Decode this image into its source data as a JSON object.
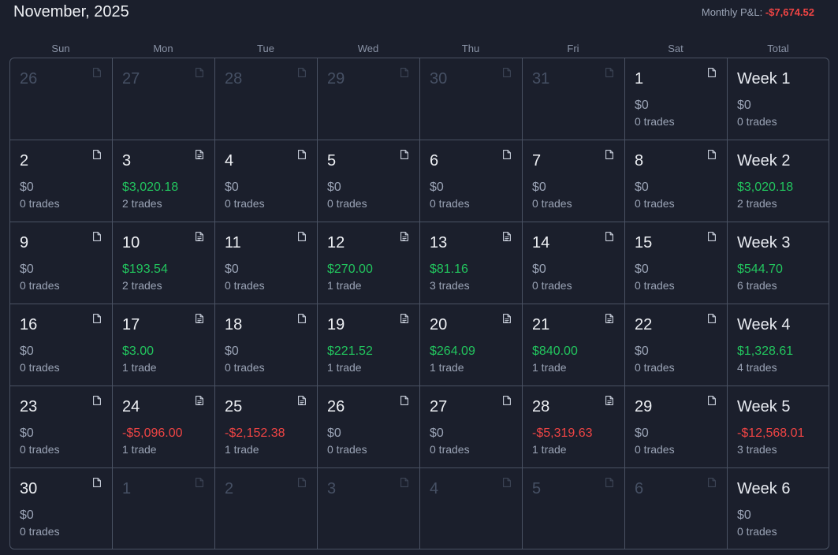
{
  "header": {
    "month_title": "November, 2025",
    "pnl_label": "Monthly P&L:",
    "pnl_value": "-$7,674.52"
  },
  "day_headers": [
    "Sun",
    "Mon",
    "Tue",
    "Wed",
    "Thu",
    "Fri",
    "Sat",
    "Total"
  ],
  "colors": {
    "positive": "#22c55e",
    "negative": "#ef4444",
    "neutral": "#9aa3b5",
    "muted_date": "#465064",
    "background": "#1b1f2c",
    "border": "#4a5263"
  },
  "weeks": [
    {
      "days": [
        {
          "date": "26",
          "muted": true,
          "note": "blank"
        },
        {
          "date": "27",
          "muted": true,
          "note": "blank"
        },
        {
          "date": "28",
          "muted": true,
          "note": "blank"
        },
        {
          "date": "29",
          "muted": true,
          "note": "blank"
        },
        {
          "date": "30",
          "muted": true,
          "note": "blank"
        },
        {
          "date": "31",
          "muted": true,
          "note": "blank"
        },
        {
          "date": "1",
          "amount": "$0",
          "trades": "0 trades",
          "sign": "zero",
          "note": "blank"
        }
      ],
      "total": {
        "label": "Week 1",
        "amount": "$0",
        "trades": "0 trades",
        "sign": "zero"
      }
    },
    {
      "days": [
        {
          "date": "2",
          "amount": "$0",
          "trades": "0 trades",
          "sign": "zero",
          "note": "blank"
        },
        {
          "date": "3",
          "amount": "$3,020.18",
          "trades": "2 trades",
          "sign": "pos",
          "note": "filled"
        },
        {
          "date": "4",
          "amount": "$0",
          "trades": "0 trades",
          "sign": "zero",
          "note": "blank"
        },
        {
          "date": "5",
          "amount": "$0",
          "trades": "0 trades",
          "sign": "zero",
          "note": "blank"
        },
        {
          "date": "6",
          "amount": "$0",
          "trades": "0 trades",
          "sign": "zero",
          "note": "blank"
        },
        {
          "date": "7",
          "amount": "$0",
          "trades": "0 trades",
          "sign": "zero",
          "note": "blank"
        },
        {
          "date": "8",
          "amount": "$0",
          "trades": "0 trades",
          "sign": "zero",
          "note": "blank"
        }
      ],
      "total": {
        "label": "Week 2",
        "amount": "$3,020.18",
        "trades": "2 trades",
        "sign": "pos"
      }
    },
    {
      "days": [
        {
          "date": "9",
          "amount": "$0",
          "trades": "0 trades",
          "sign": "zero",
          "note": "blank"
        },
        {
          "date": "10",
          "amount": "$193.54",
          "trades": "2 trades",
          "sign": "pos",
          "note": "filled"
        },
        {
          "date": "11",
          "amount": "$0",
          "trades": "0 trades",
          "sign": "zero",
          "note": "blank"
        },
        {
          "date": "12",
          "amount": "$270.00",
          "trades": "1 trade",
          "sign": "pos",
          "note": "filled"
        },
        {
          "date": "13",
          "amount": "$81.16",
          "trades": "3 trades",
          "sign": "pos",
          "note": "filled"
        },
        {
          "date": "14",
          "amount": "$0",
          "trades": "0 trades",
          "sign": "zero",
          "note": "blank"
        },
        {
          "date": "15",
          "amount": "$0",
          "trades": "0 trades",
          "sign": "zero",
          "note": "blank"
        }
      ],
      "total": {
        "label": "Week 3",
        "amount": "$544.70",
        "trades": "6 trades",
        "sign": "pos"
      }
    },
    {
      "days": [
        {
          "date": "16",
          "amount": "$0",
          "trades": "0 trades",
          "sign": "zero",
          "note": "blank"
        },
        {
          "date": "17",
          "amount": "$3.00",
          "trades": "1 trade",
          "sign": "pos",
          "note": "filled"
        },
        {
          "date": "18",
          "amount": "$0",
          "trades": "0 trades",
          "sign": "zero",
          "note": "blank"
        },
        {
          "date": "19",
          "amount": "$221.52",
          "trades": "1 trade",
          "sign": "pos",
          "note": "filled"
        },
        {
          "date": "20",
          "amount": "$264.09",
          "trades": "1 trade",
          "sign": "pos",
          "note": "filled"
        },
        {
          "date": "21",
          "amount": "$840.00",
          "trades": "1 trade",
          "sign": "pos",
          "note": "filled"
        },
        {
          "date": "22",
          "amount": "$0",
          "trades": "0 trades",
          "sign": "zero",
          "note": "blank"
        }
      ],
      "total": {
        "label": "Week 4",
        "amount": "$1,328.61",
        "trades": "4 trades",
        "sign": "pos"
      }
    },
    {
      "days": [
        {
          "date": "23",
          "amount": "$0",
          "trades": "0 trades",
          "sign": "zero",
          "note": "blank"
        },
        {
          "date": "24",
          "amount": "-$5,096.00",
          "trades": "1 trade",
          "sign": "neg",
          "note": "filled"
        },
        {
          "date": "25",
          "amount": "-$2,152.38",
          "trades": "1 trade",
          "sign": "neg",
          "note": "filled"
        },
        {
          "date": "26",
          "amount": "$0",
          "trades": "0 trades",
          "sign": "zero",
          "note": "blank"
        },
        {
          "date": "27",
          "amount": "$0",
          "trades": "0 trades",
          "sign": "zero",
          "note": "blank"
        },
        {
          "date": "28",
          "amount": "-$5,319.63",
          "trades": "1 trade",
          "sign": "neg",
          "note": "filled"
        },
        {
          "date": "29",
          "amount": "$0",
          "trades": "0 trades",
          "sign": "zero",
          "note": "blank"
        }
      ],
      "total": {
        "label": "Week 5",
        "amount": "-$12,568.01",
        "trades": "3 trades",
        "sign": "neg"
      }
    },
    {
      "days": [
        {
          "date": "30",
          "amount": "$0",
          "trades": "0 trades",
          "sign": "zero",
          "note": "blank"
        },
        {
          "date": "1",
          "muted": true,
          "note": "blank"
        },
        {
          "date": "2",
          "muted": true,
          "note": "blank"
        },
        {
          "date": "3",
          "muted": true,
          "note": "blank"
        },
        {
          "date": "4",
          "muted": true,
          "note": "blank"
        },
        {
          "date": "5",
          "muted": true,
          "note": "blank"
        },
        {
          "date": "6",
          "muted": true,
          "note": "blank"
        }
      ],
      "total": {
        "label": "Week 6",
        "amount": "$0",
        "trades": "0 trades",
        "sign": "zero"
      }
    }
  ]
}
